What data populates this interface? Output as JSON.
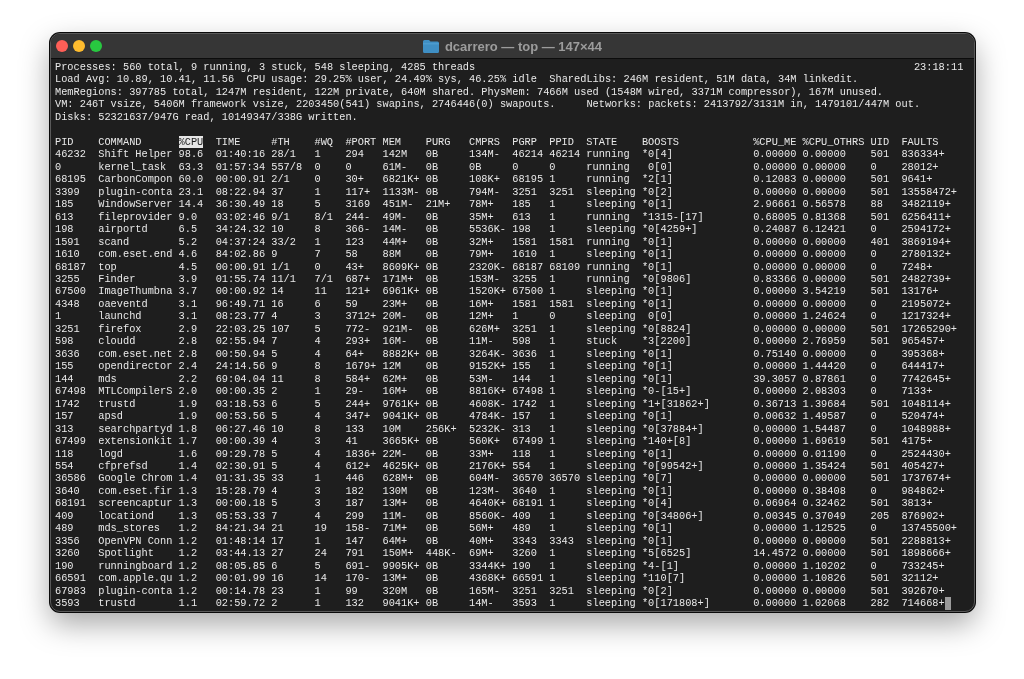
{
  "window": {
    "title": "dcarrero — top — 147×44"
  },
  "summary": {
    "lines": [
      "Processes: 560 total, 9 running, 3 stuck, 548 sleeping, 4285 threads",
      "Load Avg: 10.89, 10.41, 11.56  CPU usage: 29.25% user, 24.49% sys, 46.25% idle  SharedLibs: 246M resident, 51M data, 34M linkedit.",
      "MemRegions: 397785 total, 1247M resident, 122M private, 640M shared. PhysMem: 7466M used (1548M wired, 3371M compressor), 167M unused.",
      "VM: 246T vsize, 5406M framework vsize, 2203450(541) swapins, 2746446(0) swapouts.     Networks: packets: 2413792/3131M in, 1479101/447M out.",
      "Disks: 52321637/947G read, 10149347/338G written."
    ],
    "clock": "23:18:11"
  },
  "table": {
    "columns": [
      {
        "label": "PID",
        "selected": false
      },
      {
        "label": "COMMAND",
        "selected": false
      },
      {
        "label": "%CPU",
        "selected": true
      },
      {
        "label": "TIME",
        "selected": false
      },
      {
        "label": "#TH",
        "selected": false
      },
      {
        "label": "#WQ",
        "selected": false
      },
      {
        "label": "#PORT",
        "selected": false
      },
      {
        "label": "MEM",
        "selected": false
      },
      {
        "label": "PURG",
        "selected": false
      },
      {
        "label": "CMPRS",
        "selected": false
      },
      {
        "label": "PGRP",
        "selected": false
      },
      {
        "label": "PPID",
        "selected": false
      },
      {
        "label": "STATE",
        "selected": false
      },
      {
        "label": "BOOSTS",
        "selected": false
      },
      {
        "label": "%CPU_ME",
        "selected": false
      },
      {
        "label": "%CPU_OTHRS",
        "selected": false
      },
      {
        "label": "UID",
        "selected": false
      },
      {
        "label": "FAULTS",
        "selected": false
      }
    ],
    "rows": [
      [
        "46232",
        "Shift Helper",
        "98.6",
        "01:40:16",
        "28/1",
        "1",
        "294",
        "142M",
        "0B",
        "134M-",
        "46214",
        "46214",
        "running",
        "*0[4]",
        "0.00000",
        "0.00000",
        "501",
        "836334+"
      ],
      [
        "0",
        "kernel_task",
        "63.3",
        "01:57:34",
        "557/8",
        "0",
        "0",
        "61M-",
        "0B",
        "0B",
        "0",
        "0",
        "running",
        " 0[0]",
        "0.00000",
        "0.00000",
        "0",
        "28012+"
      ],
      [
        "68195",
        "CarbonCompon",
        "60.0",
        "00:00.91",
        "2/1",
        "0",
        "30+",
        "6821K+",
        "0B",
        "108K+",
        "68195",
        "1",
        "running",
        "*2[1]",
        "0.12083",
        "0.00000",
        "501",
        "9641+"
      ],
      [
        "3399",
        "plugin-conta",
        "23.1",
        "08:22.94",
        "37",
        "1",
        "117+",
        "1133M-",
        "0B",
        "794M-",
        "3251",
        "3251",
        "sleeping",
        "*0[2]",
        "0.00000",
        "0.00000",
        "501",
        "13558472+"
      ],
      [
        "185",
        "WindowServer",
        "14.4",
        "36:30.49",
        "18",
        "5",
        "3169",
        "451M-",
        "21M+",
        "78M+",
        "185",
        "1",
        "sleeping",
        "*0[1]",
        "2.96661",
        "0.56578",
        "88",
        "3482119+"
      ],
      [
        "613",
        "fileprovider",
        "9.0",
        "03:02:46",
        "9/1",
        "8/1",
        "244-",
        "49M-",
        "0B",
        "35M+",
        "613",
        "1",
        "running",
        "*1315-[17]",
        "0.68005",
        "0.81368",
        "501",
        "6256411+"
      ],
      [
        "198",
        "airportd",
        "6.5",
        "34:24.32",
        "10",
        "8",
        "366-",
        "14M-",
        "0B",
        "5536K-",
        "198",
        "1",
        "sleeping",
        "*0[4259+]",
        "0.24087",
        "6.12421",
        "0",
        "2594172+"
      ],
      [
        "1591",
        "scand",
        "5.2",
        "04:37:24",
        "33/2",
        "1",
        "123",
        "44M+",
        "0B",
        "32M+",
        "1581",
        "1581",
        "running",
        "*0[1]",
        "0.00000",
        "0.00000",
        "401",
        "3869194+"
      ],
      [
        "1610",
        "com.eset.end",
        "4.6",
        "84:02.86",
        "9",
        "7",
        "58",
        "88M",
        "0B",
        "79M+",
        "1610",
        "1",
        "sleeping",
        "*0[1]",
        "0.00000",
        "0.00000",
        "0",
        "2780132+"
      ],
      [
        "68187",
        "top",
        "4.5",
        "00:00.91",
        "1/1",
        "0",
        "43+",
        "8609K+",
        "0B",
        "2320K-",
        "68187",
        "68109",
        "running",
        "*0[1]",
        "0.00000",
        "0.00000",
        "0",
        "7248+"
      ],
      [
        "3255",
        "Finder",
        "3.9",
        "01:55.74",
        "11/1",
        "7/1",
        "687+",
        "171M+",
        "0B",
        "153M-",
        "3255",
        "1",
        "running",
        "*0[9806]",
        "0.83366",
        "0.00000",
        "501",
        "2482739+"
      ],
      [
        "67500",
        "ImageThumbna",
        "3.7",
        "00:00.92",
        "14",
        "11",
        "121+",
        "6961K+",
        "0B",
        "1520K+",
        "67500",
        "1",
        "sleeping",
        "*0[1]",
        "0.00000",
        "3.54219",
        "501",
        "13176+"
      ],
      [
        "4348",
        "oaeventd",
        "3.1",
        "96:49.71",
        "16",
        "6",
        "59",
        "23M+",
        "0B",
        "16M+",
        "1581",
        "1581",
        "sleeping",
        "*0[1]",
        "0.00000",
        "0.00000",
        "0",
        "2195072+"
      ],
      [
        "1",
        "launchd",
        "3.1",
        "08:23.77",
        "4",
        "3",
        "3712+",
        "20M-",
        "0B",
        "12M+",
        "1",
        "0",
        "sleeping",
        " 0[0]",
        "0.00000",
        "1.24624",
        "0",
        "1217324+"
      ],
      [
        "3251",
        "firefox",
        "2.9",
        "22:03.25",
        "107",
        "5",
        "772-",
        "921M-",
        "0B",
        "626M+",
        "3251",
        "1",
        "sleeping",
        "*0[8824]",
        "0.00000",
        "0.00000",
        "501",
        "17265290+"
      ],
      [
        "598",
        "cloudd",
        "2.8",
        "02:55.94",
        "7",
        "4",
        "293+",
        "16M-",
        "0B",
        "11M-",
        "598",
        "1",
        "stuck",
        "*3[2200]",
        "0.00000",
        "2.76959",
        "501",
        "965457+"
      ],
      [
        "3636",
        "com.eset.net",
        "2.8",
        "00:50.94",
        "5",
        "4",
        "64+",
        "8882K+",
        "0B",
        "3264K-",
        "3636",
        "1",
        "sleeping",
        "*0[1]",
        "0.75140",
        "0.00000",
        "0",
        "395368+"
      ],
      [
        "155",
        "opendirector",
        "2.4",
        "24:14.56",
        "9",
        "8",
        "1679+",
        "12M",
        "0B",
        "9152K+",
        "155",
        "1",
        "sleeping",
        "*0[1]",
        "0.00000",
        "1.44420",
        "0",
        "644417+"
      ],
      [
        "144",
        "mds",
        "2.2",
        "69:04.04",
        "11",
        "8",
        "584+",
        "62M+",
        "0B",
        "53M-",
        "144",
        "1",
        "sleeping",
        "*0[1]",
        "39.3057",
        "0.87861",
        "0",
        "7742645+"
      ],
      [
        "67498",
        "MTLCompilerS",
        "2.0",
        "00:00.35",
        "2",
        "1",
        "29-",
        "16M+",
        "0B",
        "8816K+",
        "67498",
        "1",
        "sleeping",
        "*0-[15+]",
        "0.00000",
        "2.08303",
        "0",
        "7133+"
      ],
      [
        "1742",
        "trustd",
        "1.9",
        "03:18.53",
        "6",
        "5",
        "244+",
        "9761K+",
        "0B",
        "4608K-",
        "1742",
        "1",
        "sleeping",
        "*1+[31862+]",
        "0.36713",
        "1.39684",
        "501",
        "1048114+"
      ],
      [
        "157",
        "apsd",
        "1.9",
        "00:53.56",
        "5",
        "4",
        "347+",
        "9041K+",
        "0B",
        "4784K-",
        "157",
        "1",
        "sleeping",
        "*0[1]",
        "0.00632",
        "1.49587",
        "0",
        "520474+"
      ],
      [
        "313",
        "searchpartyd",
        "1.8",
        "06:27.46",
        "10",
        "8",
        "133",
        "10M",
        "256K+",
        "5232K-",
        "313",
        "1",
        "sleeping",
        "*0[37884+]",
        "0.00000",
        "1.54487",
        "0",
        "1048988+"
      ],
      [
        "67499",
        "extensionkit",
        "1.7",
        "00:00.39",
        "4",
        "3",
        "41",
        "3665K+",
        "0B",
        "560K+",
        "67499",
        "1",
        "sleeping",
        "*140+[8]",
        "0.00000",
        "1.69619",
        "501",
        "4175+"
      ],
      [
        "118",
        "logd",
        "1.6",
        "09:29.78",
        "5",
        "4",
        "1836+",
        "22M-",
        "0B",
        "33M+",
        "118",
        "1",
        "sleeping",
        "*0[1]",
        "0.00000",
        "0.01190",
        "0",
        "2524430+"
      ],
      [
        "554",
        "cfprefsd",
        "1.4",
        "02:30.91",
        "5",
        "4",
        "612+",
        "4625K+",
        "0B",
        "2176K+",
        "554",
        "1",
        "sleeping",
        "*0[99542+]",
        "0.00000",
        "1.35424",
        "501",
        "405427+"
      ],
      [
        "36586",
        "Google Chrom",
        "1.4",
        "01:31.35",
        "33",
        "1",
        "446",
        "628M+",
        "0B",
        "604M-",
        "36570",
        "36570",
        "sleeping",
        "*0[7]",
        "0.00000",
        "0.00000",
        "501",
        "1737674+"
      ],
      [
        "3640",
        "com.eset.fir",
        "1.3",
        "15:28.79",
        "4",
        "3",
        "182",
        "130M",
        "0B",
        "123M-",
        "3640",
        "1",
        "sleeping",
        "*0[1]",
        "0.00000",
        "0.38408",
        "0",
        "984862+"
      ],
      [
        "68191",
        "screencaptur",
        "1.3",
        "00:00.18",
        "5",
        "3",
        "187",
        "13M+",
        "0B",
        "4640K+",
        "68191",
        "1",
        "sleeping",
        "*0[4]",
        "0.06964",
        "0.32462",
        "501",
        "3813+"
      ],
      [
        "409",
        "locationd",
        "1.3",
        "05:53.33",
        "7",
        "4",
        "299",
        "11M-",
        "0B",
        "8560K-",
        "409",
        "1",
        "sleeping",
        "*0[34806+]",
        "0.00345",
        "0.37049",
        "205",
        "876902+"
      ],
      [
        "489",
        "mds_stores",
        "1.2",
        "84:21.34",
        "21",
        "19",
        "158-",
        "71M+",
        "0B",
        "56M+",
        "489",
        "1",
        "sleeping",
        "*0[1]",
        "0.00000",
        "1.12525",
        "0",
        "13745500+"
      ],
      [
        "3356",
        "OpenVPN Conn",
        "1.2",
        "01:48:14",
        "17",
        "1",
        "147",
        "64M+",
        "0B",
        "40M+",
        "3343",
        "3343",
        "sleeping",
        "*0[1]",
        "0.00000",
        "0.00000",
        "501",
        "2288813+"
      ],
      [
        "3260",
        "Spotlight",
        "1.2",
        "03:44.13",
        "27",
        "24",
        "791",
        "150M+",
        "448K-",
        "69M+",
        "3260",
        "1",
        "sleeping",
        "*5[6525]",
        "14.4572",
        "0.00000",
        "501",
        "1898666+"
      ],
      [
        "190",
        "runningboard",
        "1.2",
        "08:05.85",
        "6",
        "5",
        "691-",
        "9905K+",
        "0B",
        "3344K+",
        "190",
        "1",
        "sleeping",
        "*4-[1]",
        "0.00000",
        "1.10202",
        "0",
        "733245+"
      ],
      [
        "66591",
        "com.apple.qu",
        "1.2",
        "00:01.99",
        "16",
        "14",
        "170-",
        "13M+",
        "0B",
        "4368K+",
        "66591",
        "1",
        "sleeping",
        "*110[7]",
        "0.00000",
        "1.10826",
        "501",
        "32112+"
      ],
      [
        "67983",
        "plugin-conta",
        "1.2",
        "00:14.78",
        "23",
        "1",
        "99",
        "320M",
        "0B",
        "165M-",
        "3251",
        "3251",
        "sleeping",
        "*0[2]",
        "0.00000",
        "0.00000",
        "501",
        "392670+"
      ],
      [
        "3593",
        "trustd",
        "1.1",
        "02:59.72",
        "2",
        "1",
        "132",
        "9041K+",
        "0B",
        "14M-",
        "3593",
        "1",
        "sleeping",
        "*0[171808+]",
        "0.00000",
        "1.02068",
        "282",
        "714668+"
      ]
    ]
  },
  "terminal": {
    "cursor": true
  }
}
